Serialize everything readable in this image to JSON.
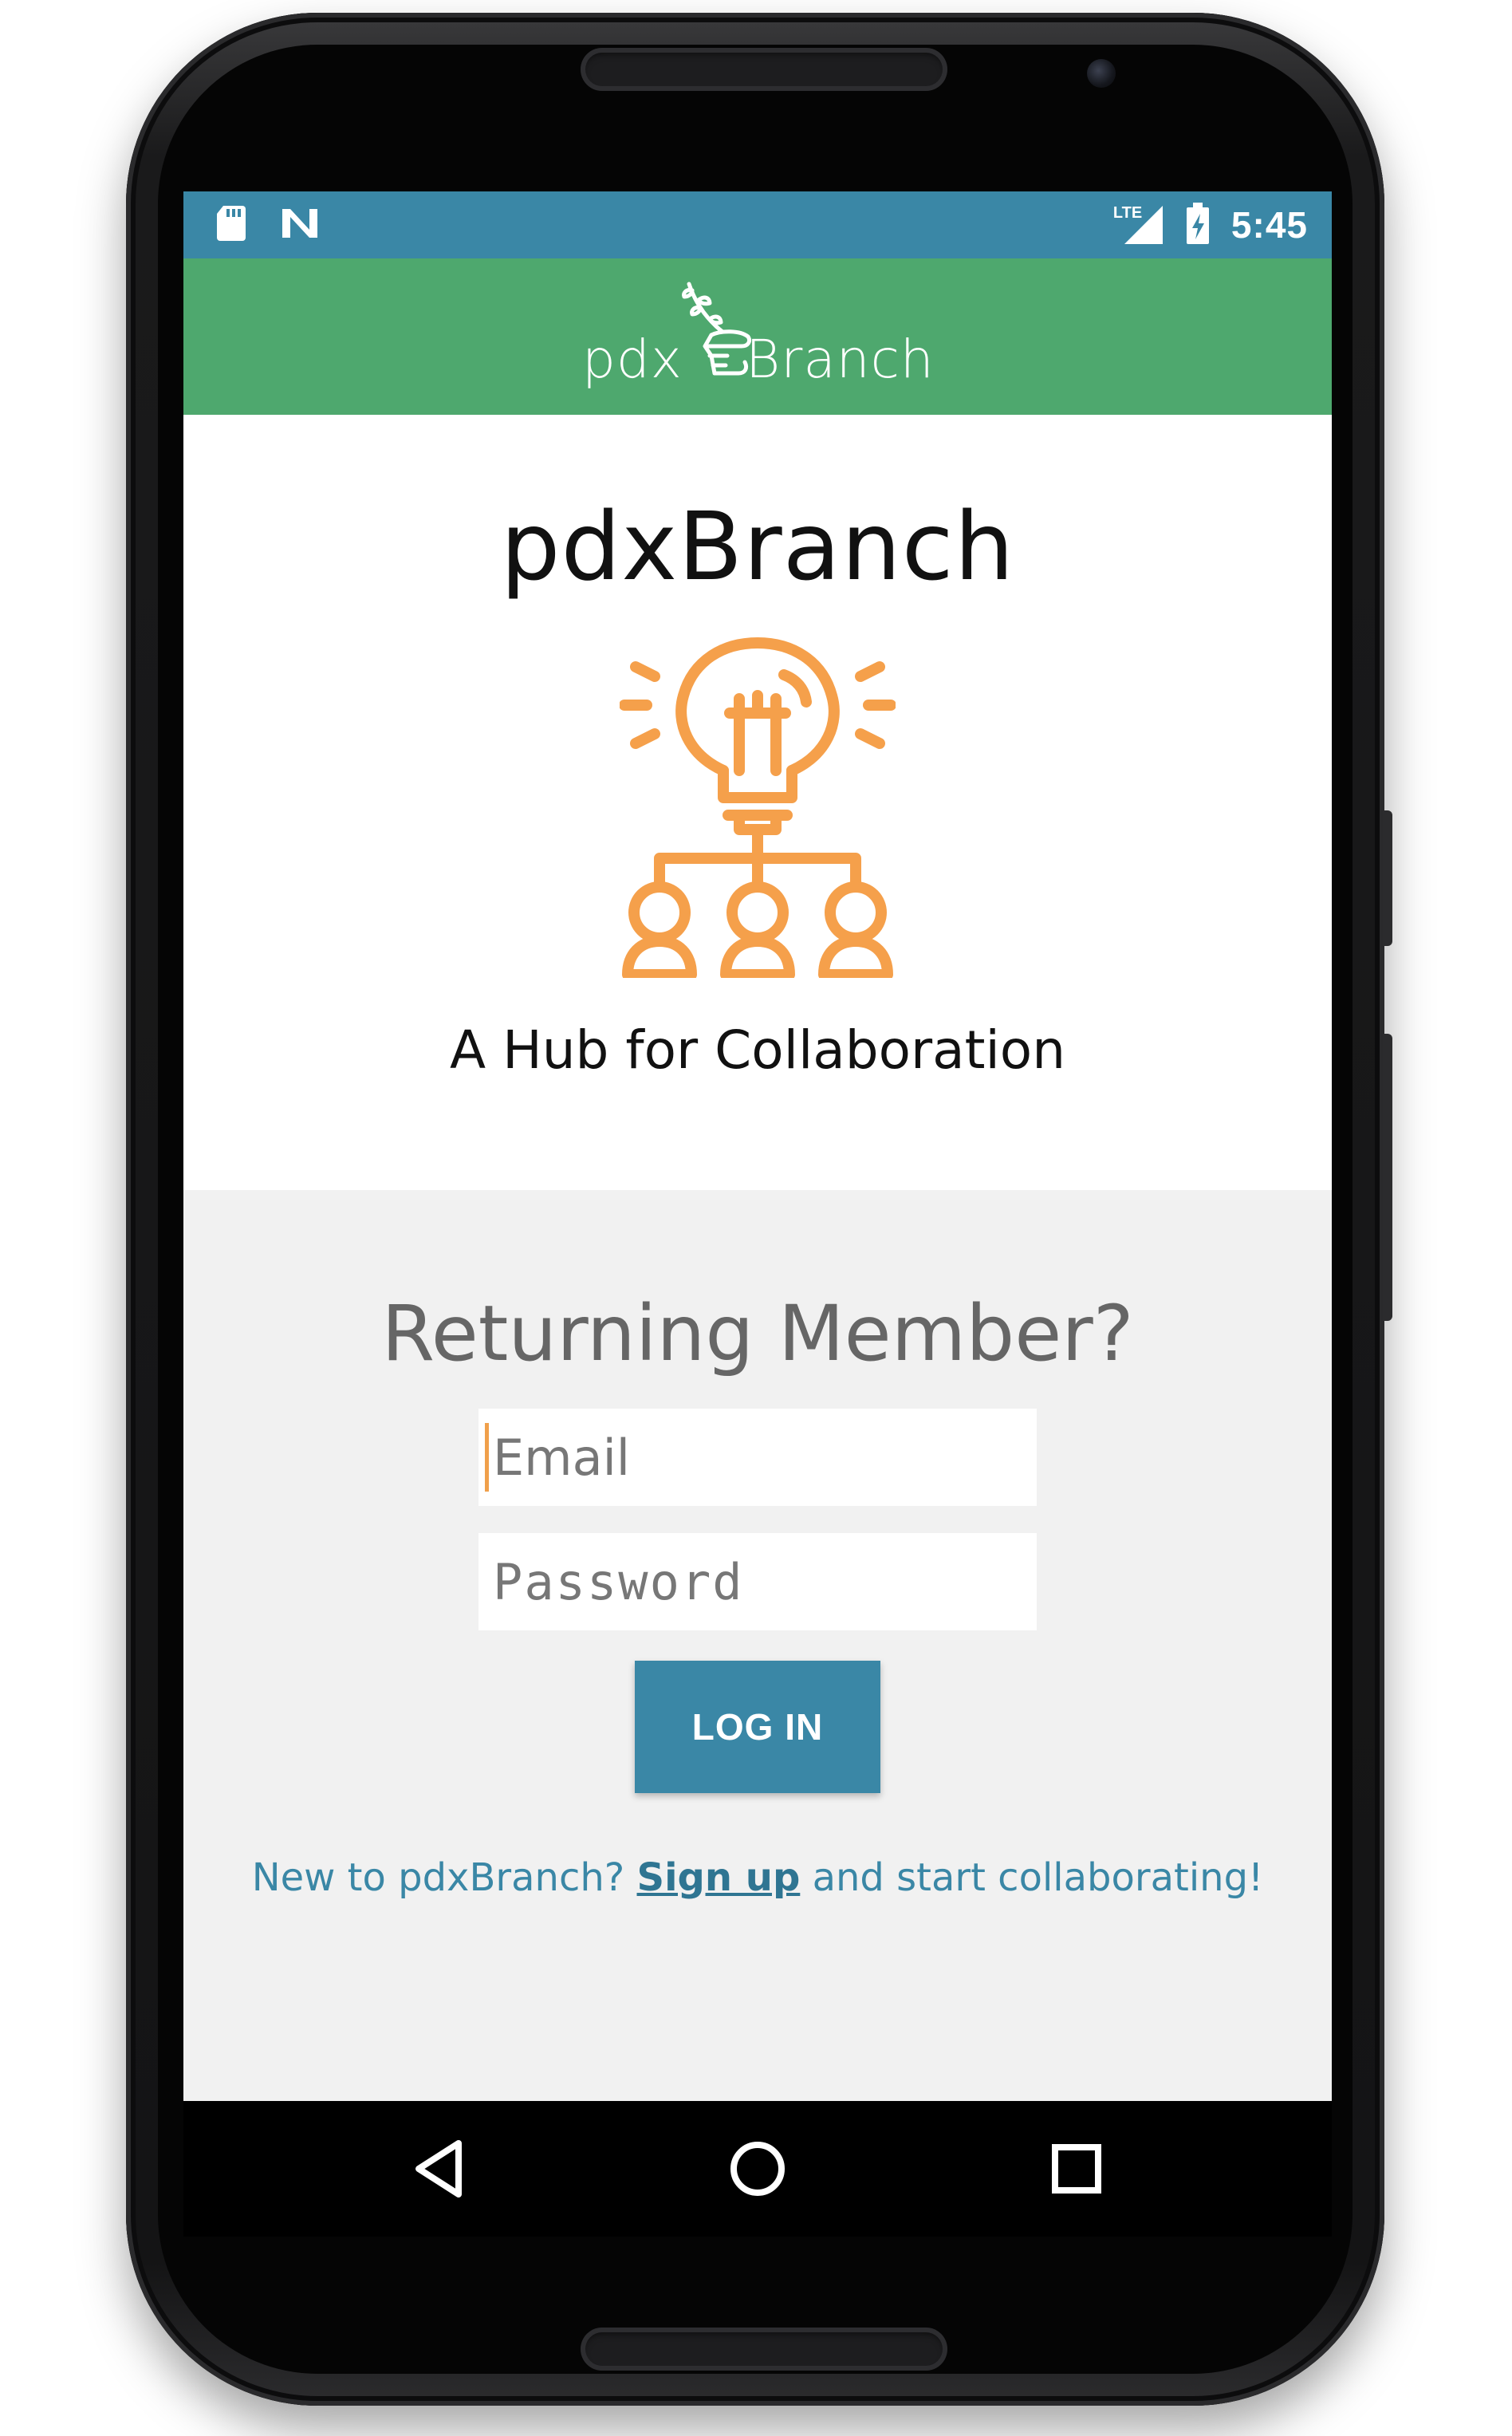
{
  "colors": {
    "status_bar": "#3a87a6",
    "app_bar": "#4ea86e",
    "illustration": "#f5a04b",
    "login_button": "#3a87a6",
    "link": "#3a87a6",
    "login_bg": "#f1f1f1"
  },
  "status_bar": {
    "icons_left": [
      "sd-card-icon",
      "n-notification-icon"
    ],
    "network": "LTE",
    "icons_right": [
      "lte-signal-icon",
      "battery-charging-icon"
    ],
    "time": "5:45"
  },
  "app_bar": {
    "logo_left": "pdx",
    "logo_right": "Branch",
    "logo_icon": "branch-hand-icon"
  },
  "hero": {
    "title": "pdxBranch",
    "illustration_icon": "lightbulb-team-icon",
    "tagline": "A Hub for Collaboration"
  },
  "login": {
    "heading": "Returning Member?",
    "email_placeholder": "Email",
    "email_value": "",
    "password_placeholder": "Password",
    "password_value": "",
    "button_label": "LOG IN",
    "signup_prefix": "New to pdxBranch?",
    "signup_link": "Sign up",
    "signup_suffix": "and start collaborating!"
  },
  "nav_bar": {
    "back_icon": "back-triangle-icon",
    "home_icon": "home-circle-icon",
    "recent_icon": "recent-apps-square-icon"
  }
}
